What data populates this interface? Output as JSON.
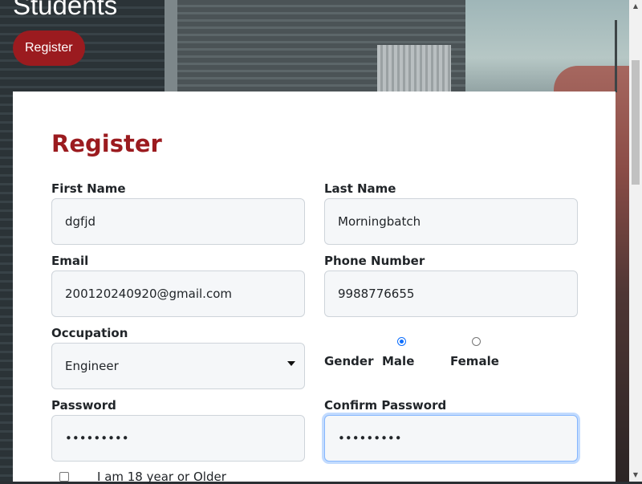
{
  "header": {
    "title": "Students",
    "register_button": "Register"
  },
  "form": {
    "heading": "Register",
    "first_name": {
      "label": "First Name",
      "value": "dgfjd"
    },
    "last_name": {
      "label": "Last Name",
      "value": "Morningbatch"
    },
    "email": {
      "label": "Email",
      "value": "200120240920@gmail.com"
    },
    "phone": {
      "label": "Phone Number",
      "value": "9988776655"
    },
    "occupation": {
      "label": "Occupation",
      "value": "Engineer"
    },
    "gender": {
      "label": "Gender",
      "options": [
        {
          "label": "Male",
          "checked": true
        },
        {
          "label": "Female",
          "checked": false
        }
      ]
    },
    "password": {
      "label": "Password",
      "value": "•••••••••"
    },
    "confirm_password": {
      "label": "Confirm Password",
      "value": "•••••••••"
    },
    "age_check": {
      "label": "I am 18 year or Older",
      "checked": false
    }
  },
  "colors": {
    "accent": "#9b1b1f",
    "radio_selected": "#0d6efd",
    "focus_ring": "#86b7fe"
  },
  "icons": {
    "select_caret": "caret-down-icon",
    "scroll_up": "triangle-up-icon",
    "scroll_down": "triangle-down-icon"
  }
}
